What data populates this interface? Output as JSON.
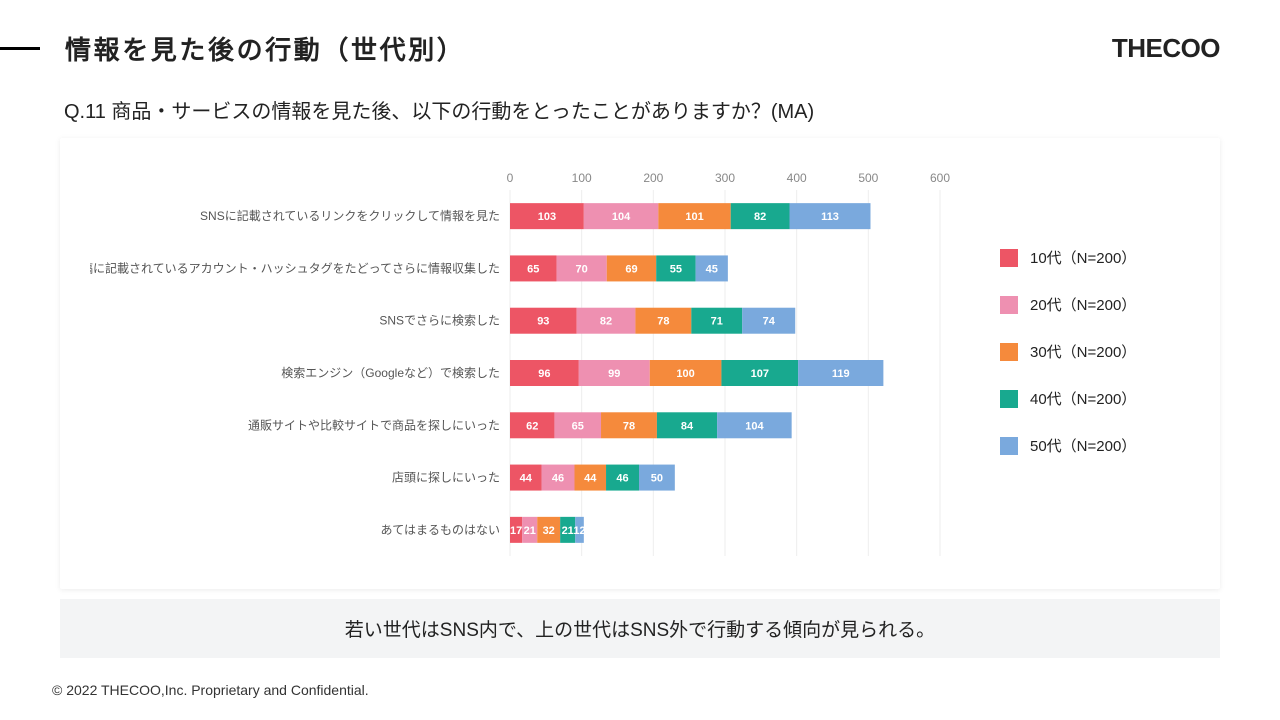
{
  "header": {
    "title": "情報を見た後の行動（世代別）",
    "brand": "THECOO"
  },
  "question": "Q.11 商品・サービスの情報を見た後、以下の行動をとったことがありますか？(MA)",
  "note": "若い世代はSNS内で、上の世代はSNS外で行動する傾向が見られる。",
  "footer": "© 2022 THECOO,Inc. Proprietary and Confidential.",
  "legend": [
    {
      "name": "10代（N=200）",
      "color": "#ed5565"
    },
    {
      "name": "20代（N=200）",
      "color": "#ee90b1"
    },
    {
      "name": "30代（N=200）",
      "color": "#f58a3c"
    },
    {
      "name": "40代（N=200）",
      "color": "#18a98f"
    },
    {
      "name": "50代（N=200）",
      "color": "#7aa9dd"
    }
  ],
  "chart_data": {
    "type": "bar",
    "stacked": true,
    "orientation": "horizontal",
    "xlim": [
      0,
      600
    ],
    "xticks": [
      0,
      100,
      200,
      300,
      400,
      500,
      600
    ],
    "categories": [
      "SNSに記載されているリンクをクリックして情報を見た",
      "投稿に記載されているアカウント・ハッシュタグをたどってさらに情報収集した",
      "SNSでさらに検索した",
      "検索エンジン（Googleなど）で検索した",
      "通販サイトや比較サイトで商品を探しにいった",
      "店頭に探しにいった",
      "あてはまるものはない"
    ],
    "series": [
      {
        "name": "10代（N=200）",
        "color": "#ed5565",
        "values": [
          103,
          65,
          93,
          96,
          62,
          44,
          17
        ]
      },
      {
        "name": "20代（N=200）",
        "color": "#ee90b1",
        "values": [
          104,
          70,
          82,
          99,
          65,
          46,
          21
        ]
      },
      {
        "name": "30代（N=200）",
        "color": "#f58a3c",
        "values": [
          101,
          69,
          78,
          100,
          78,
          44,
          32
        ]
      },
      {
        "name": "40代（N=200）",
        "color": "#18a98f",
        "values": [
          82,
          55,
          71,
          107,
          84,
          46,
          21
        ]
      },
      {
        "name": "50代（N=200）",
        "color": "#7aa9dd",
        "values": [
          113,
          45,
          74,
          119,
          104,
          50,
          12
        ]
      }
    ]
  }
}
